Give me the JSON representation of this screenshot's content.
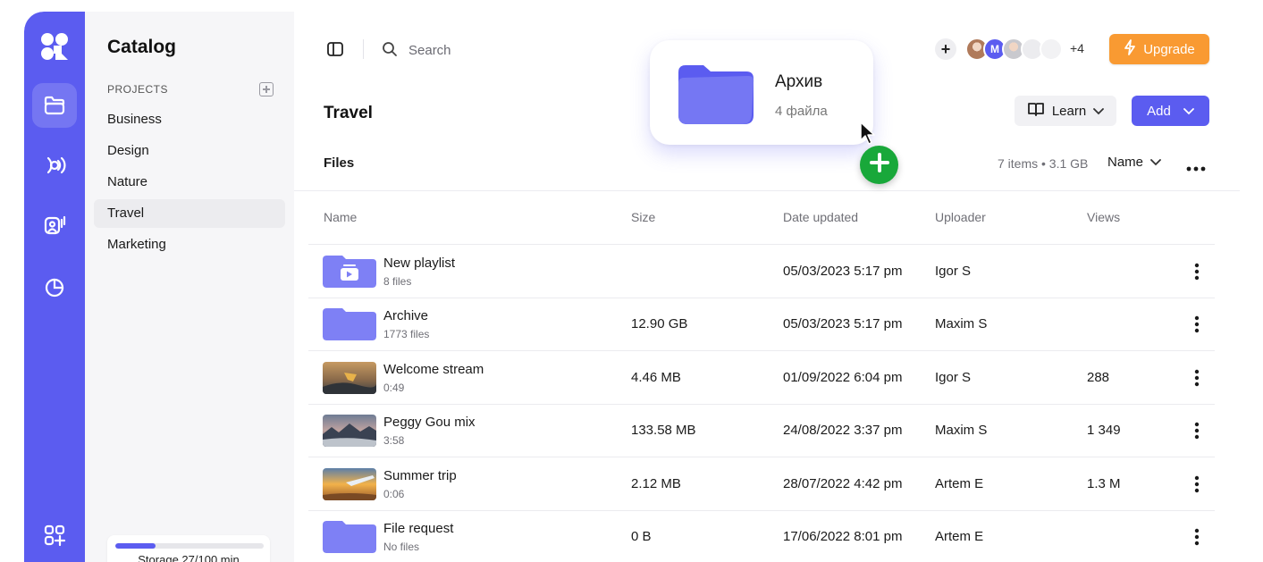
{
  "sidebar": {
    "title": "Catalog",
    "section_label": "PROJECTS",
    "projects": [
      {
        "label": "Business"
      },
      {
        "label": "Design"
      },
      {
        "label": "Nature"
      },
      {
        "label": "Travel"
      },
      {
        "label": "Marketing"
      }
    ],
    "active_project": "Travel",
    "storage": {
      "label": "Storage 27/100 min",
      "used": 27,
      "total": 100
    }
  },
  "rail": {
    "icons": [
      "app-logo-icon",
      "folder-icon",
      "broadcast-icon",
      "podcast-icon",
      "analytics-icon",
      "apps-add-icon"
    ],
    "active": "folder-icon"
  },
  "topbar": {
    "search_placeholder": "Search",
    "avatars": [
      {
        "type": "photo",
        "color": "#b07a5a"
      },
      {
        "type": "initial",
        "initial": "M",
        "color": "#5b5cf0"
      },
      {
        "type": "photo",
        "color": "#c9c9ce"
      },
      {
        "type": "blank",
        "color": "#ececef"
      },
      {
        "type": "blank",
        "color": "#f2f2f4"
      }
    ],
    "extra_members": "+4",
    "upgrade_label": "Upgrade"
  },
  "page": {
    "title": "Travel",
    "learn_label": "Learn",
    "add_label": "Add",
    "files_label": "Files",
    "summary": "7 items • 3.1 GB",
    "sort_label": "Name"
  },
  "table": {
    "columns": [
      "Name",
      "Size",
      "Date updated",
      "Uploader",
      "Views"
    ],
    "rows": [
      {
        "name": "New playlist",
        "sub": "8 files",
        "size": "",
        "date": "05/03/2023 5:17 pm",
        "uploader": "Igor S",
        "views": "",
        "thumb": "playlist-folder"
      },
      {
        "name": "Archive",
        "sub": "1773 files",
        "size": "12.90 GB",
        "date": "05/03/2023 5:17 pm",
        "uploader": "Maxim S",
        "views": "",
        "thumb": "folder"
      },
      {
        "name": "Welcome stream",
        "sub": "0:49",
        "size": "4.46 MB",
        "date": "01/09/2022 6:04 pm",
        "uploader": "Igor S",
        "views": "288",
        "thumb": "video-1"
      },
      {
        "name": "Peggy Gou mix",
        "sub": "3:58",
        "size": "133.58 MB",
        "date": "24/08/2022 3:37 pm",
        "uploader": "Maxim S",
        "views": "1 349",
        "thumb": "video-2"
      },
      {
        "name": "Summer trip",
        "sub": "0:06",
        "size": "2.12 MB",
        "date": "28/07/2022 4:42 pm",
        "uploader": "Artem E",
        "views": "1.3 M",
        "thumb": "video-3"
      },
      {
        "name": "File request",
        "sub": "No files",
        "size": "0 B",
        "date": "17/06/2022 8:01 pm",
        "uploader": "Artem E",
        "views": "",
        "thumb": "folder"
      }
    ]
  },
  "drag_card": {
    "name": "Архив",
    "count": "4 файла"
  },
  "colors": {
    "accent": "#5b5cf0",
    "folder": "#7e80f5",
    "upgrade": "#f99a32",
    "drop_plus": "#19a83a"
  }
}
